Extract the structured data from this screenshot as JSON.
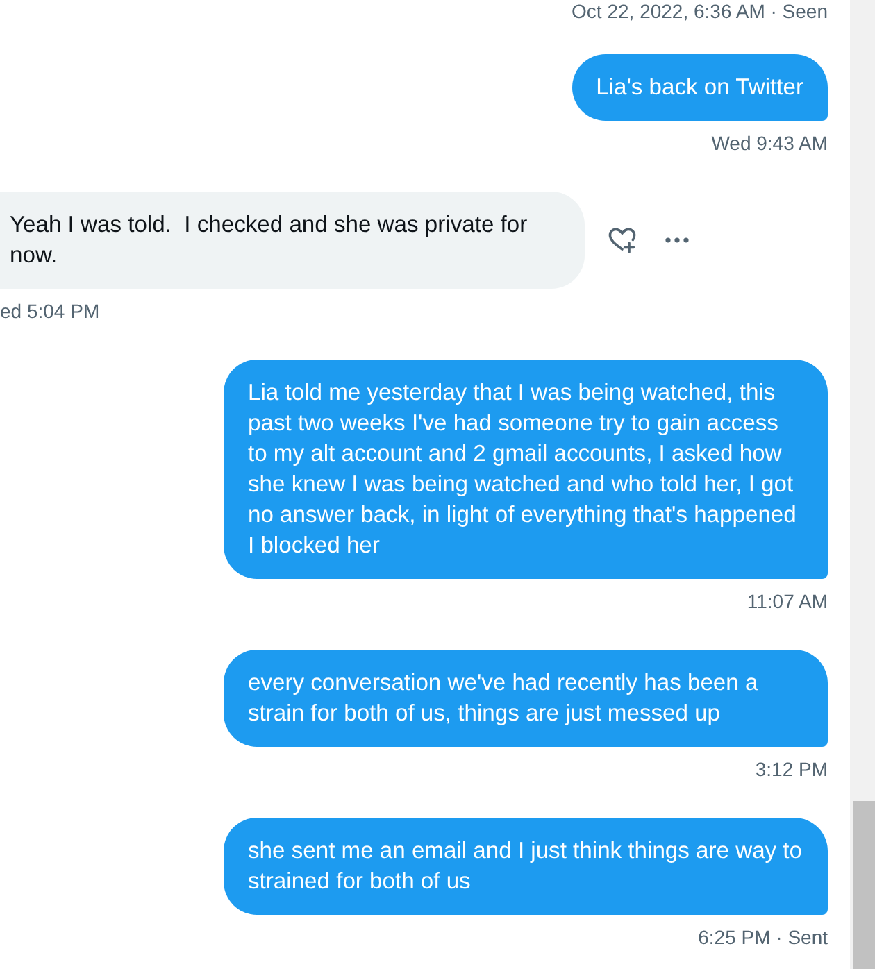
{
  "conversation": {
    "top_status": "Oct 22, 2022, 6:36 AM · Seen",
    "messages": [
      {
        "kind": "sent",
        "text": "Lia's back on Twitter",
        "timestamp": "Wed 9:43 AM",
        "actions_visible": false
      },
      {
        "kind": "received",
        "text": "Yeah I was told.  I checked and she was private for now.",
        "timestamp": "ed 5:04 PM",
        "actions_visible": true
      },
      {
        "kind": "sent",
        "text": "Lia told me yesterday that I was being watched, this past two weeks I've had someone try to gain access to my alt account and 2 gmail accounts, I asked how she knew I was being watched and who told her, I got no answer back, in light of everything that's happened I blocked her",
        "timestamp": "11:07 AM",
        "actions_visible": false
      },
      {
        "kind": "sent",
        "text": "every conversation we've had recently has been a strain for both of us, things are just messed up",
        "timestamp": "3:12 PM",
        "actions_visible": false
      },
      {
        "kind": "sent",
        "text": "she sent me an email and I just think things are way to strained for both of us",
        "timestamp": "6:25 PM · Sent",
        "actions_visible": false
      }
    ]
  }
}
